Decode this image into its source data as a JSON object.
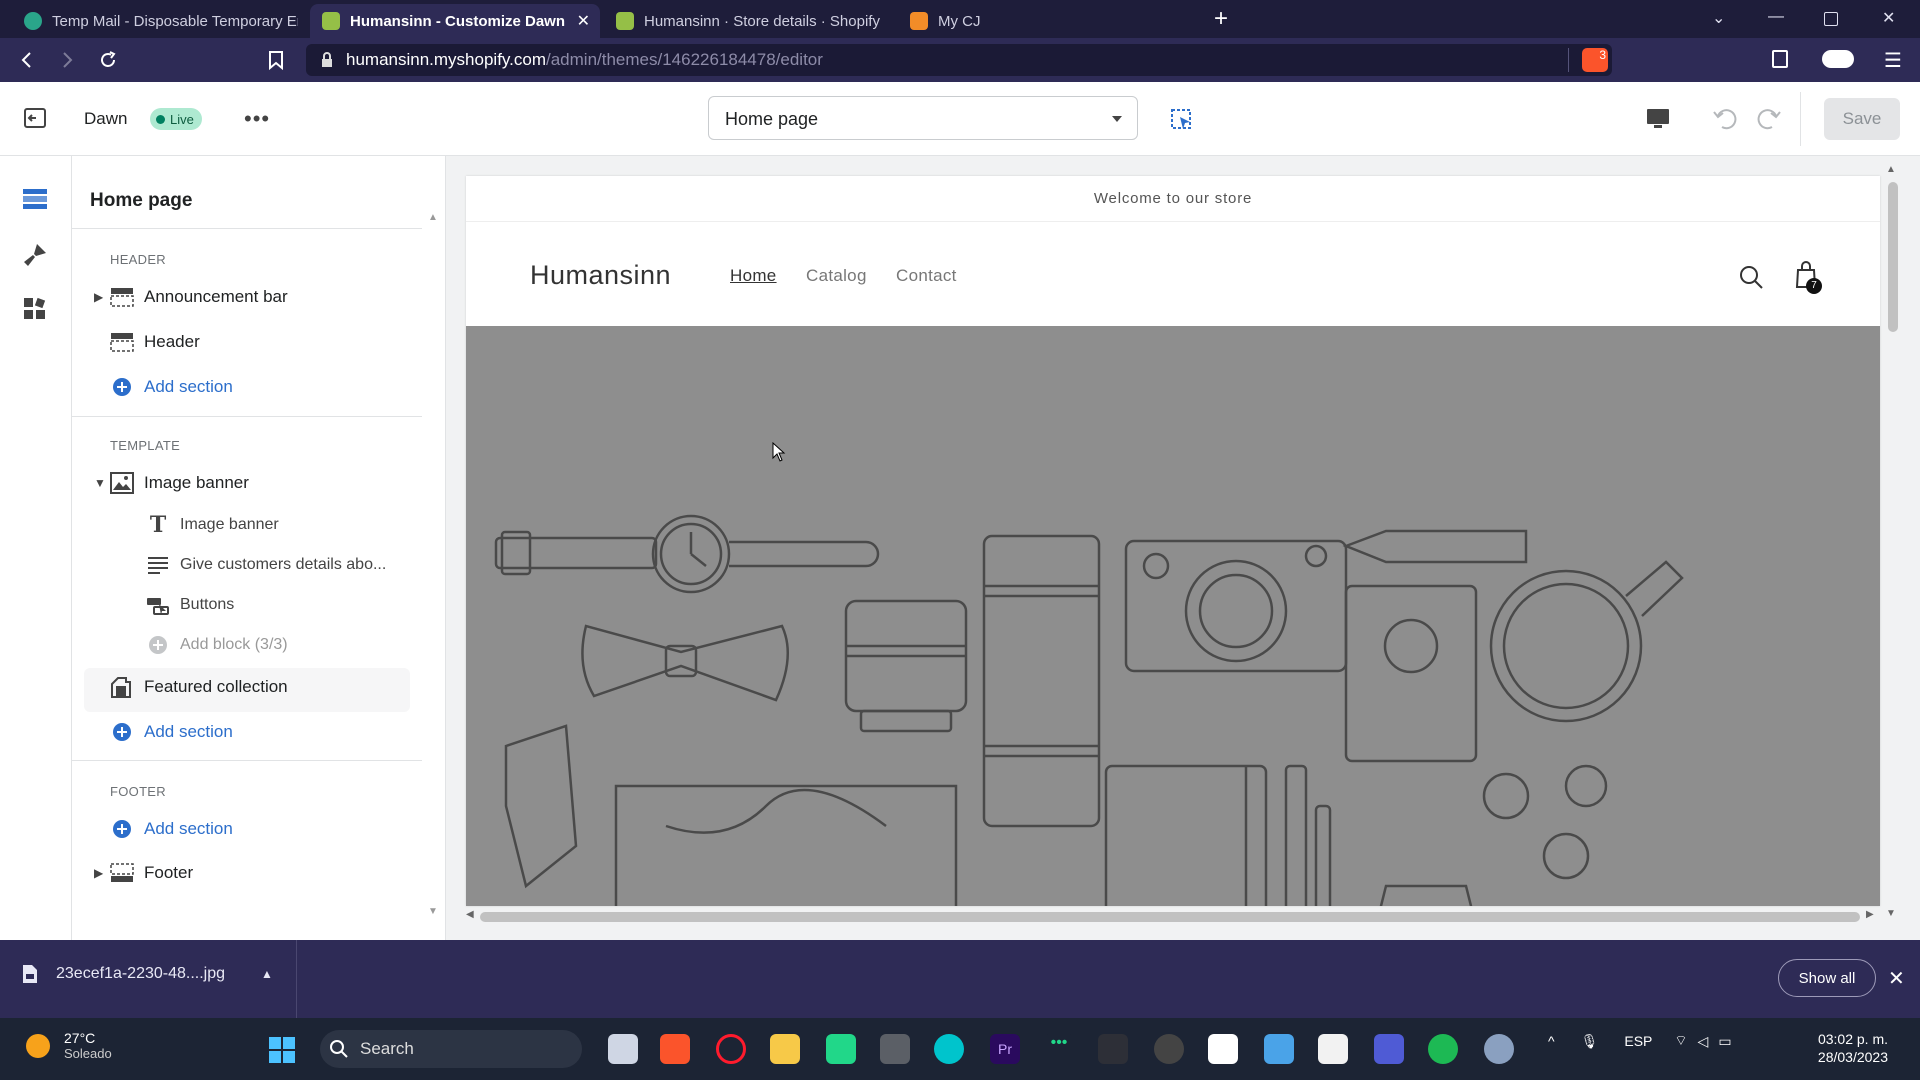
{
  "browser": {
    "tabs": [
      {
        "label": "Temp Mail - Disposable Temporary Em",
        "active": false
      },
      {
        "label": "Humansinn - Customize Dawn · Sl",
        "active": true
      },
      {
        "label": "Humansinn · Store details · Shopify",
        "active": false
      },
      {
        "label": "My CJ",
        "active": false
      }
    ],
    "url_host": "humansinn.myshopify.com",
    "url_path": "/admin/themes/146226184478/editor",
    "shield_count": "3"
  },
  "editor": {
    "theme_name": "Dawn",
    "live_badge": "Live",
    "page_selector": "Home page",
    "save_label": "Save"
  },
  "sidebar": {
    "title": "Home page",
    "header_group": "HEADER",
    "announcement_bar": "Announcement bar",
    "header": "Header",
    "add_section": "Add section",
    "template_group": "TEMPLATE",
    "image_banner": "Image banner",
    "blocks": [
      {
        "label": "Image banner",
        "icon": "text-icon"
      },
      {
        "label": "Give customers details abo...",
        "icon": "paragraph-icon"
      },
      {
        "label": "Buttons",
        "icon": "buttons-icon"
      },
      {
        "label": "Add block (3/3)",
        "icon": "add-icon"
      }
    ],
    "featured_collection": "Featured collection",
    "footer_group": "FOOTER",
    "footer": "Footer"
  },
  "preview": {
    "announcement": "Welcome to our store",
    "store_name": "Humansinn",
    "nav": [
      "Home",
      "Catalog",
      "Contact"
    ],
    "cart_count": "7"
  },
  "downloads": {
    "file": "23ecef1a-2230-48....jpg",
    "show_all": "Show all"
  },
  "taskbar": {
    "temperature": "27°C",
    "condition": "Soleado",
    "search": "Search",
    "lang": "ESP",
    "time": "03:02 p. m.",
    "date": "28/03/2023"
  }
}
